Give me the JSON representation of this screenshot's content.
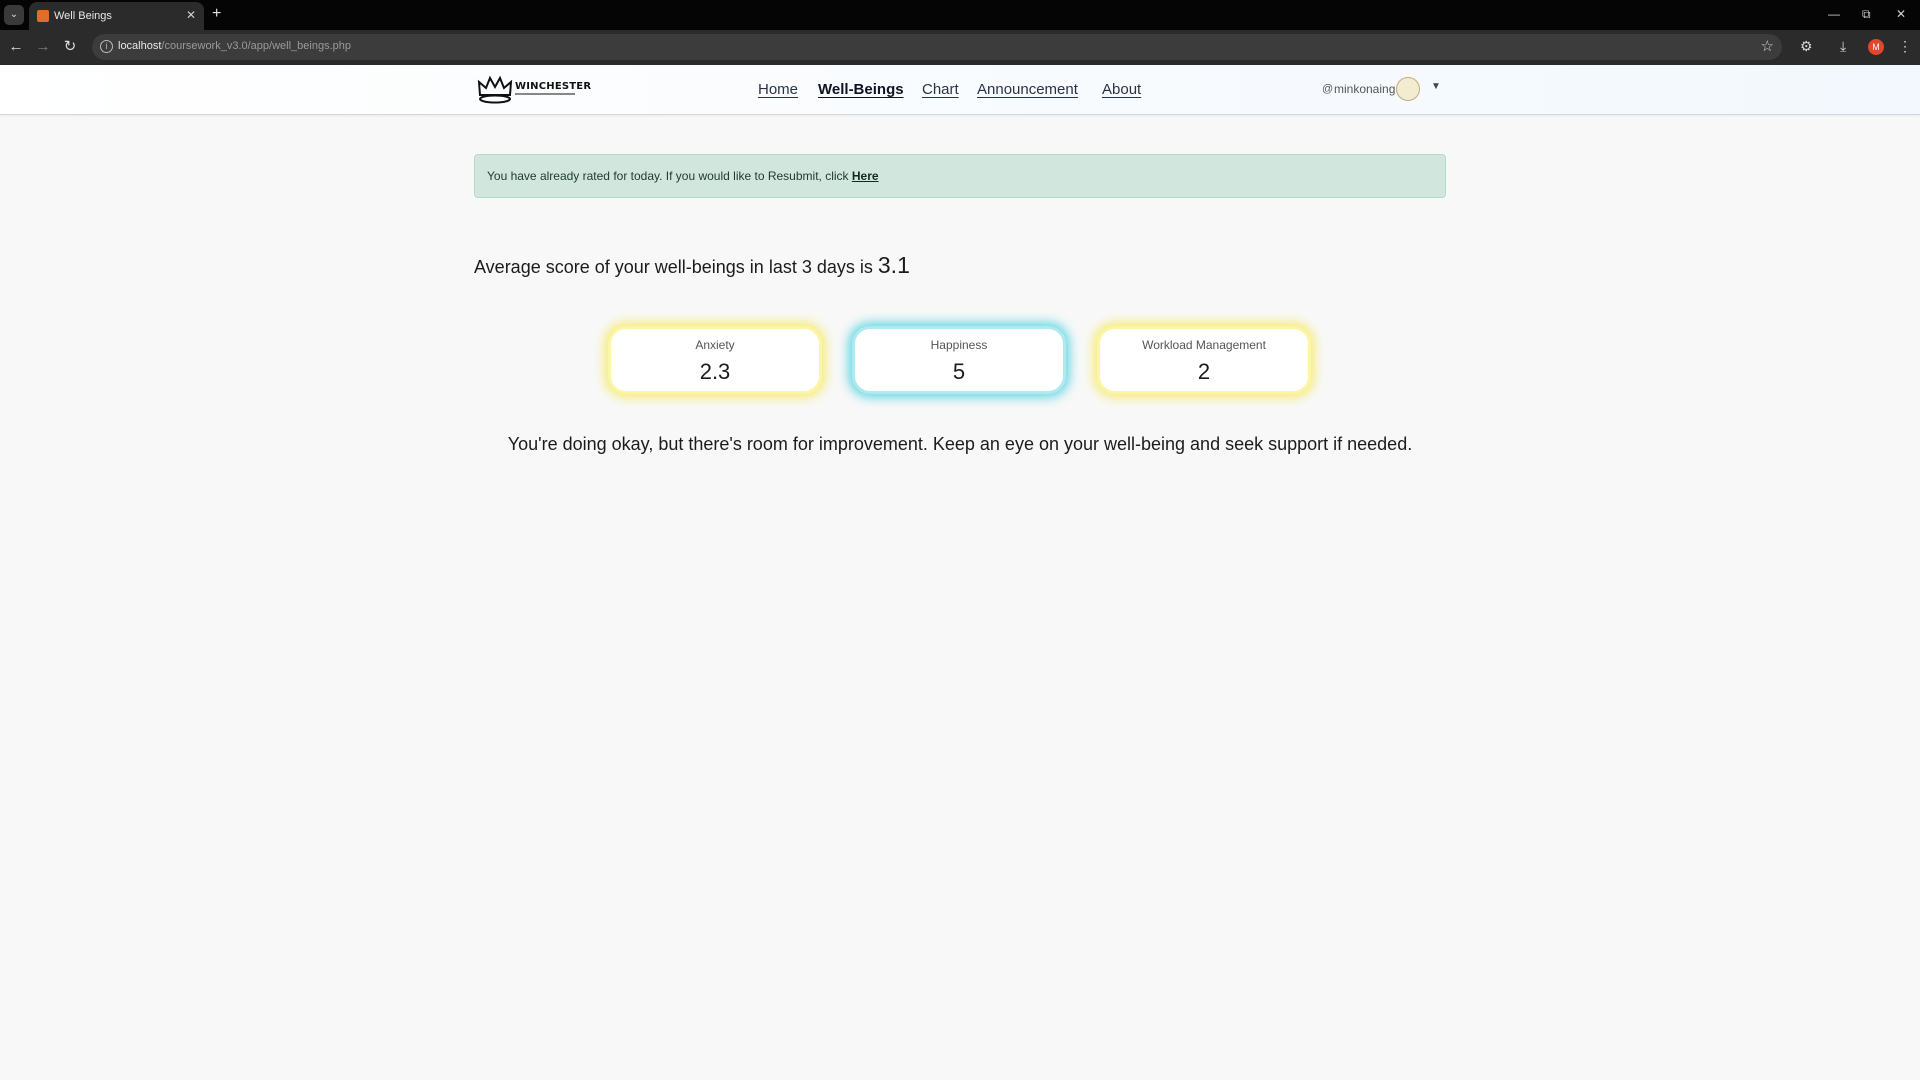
{
  "browser": {
    "tab_title": "Well Beings",
    "url_host": "localhost",
    "url_path": "/coursework_v3.0/app/well_beings.php",
    "profile_initial": "M"
  },
  "navbar": {
    "logo_text": "WINCHESTER",
    "links": [
      "Home",
      "Well-Beings",
      "Chart",
      "Announcement",
      "About"
    ],
    "active_link": "Well-Beings",
    "user_at": "@",
    "username": "minkonaing"
  },
  "alert": {
    "text": "You have already rated for today. If you would like to Resubmit, click",
    "link_label": "Here",
    "color": "#d1e7dd"
  },
  "summary": {
    "prefix": "Average score of your well-beings in last 3 days is",
    "value": "3.1"
  },
  "cards": [
    {
      "label": "Anxiety",
      "value": "2.3",
      "glow": "yellow"
    },
    {
      "label": "Happiness",
      "value": "5",
      "glow": "cyan"
    },
    {
      "label": "Workload Management",
      "value": "2",
      "glow": "yellow"
    }
  ],
  "message": "You're doing okay, but there's room for improvement. Keep an eye on your well-being and seek support if needed.",
  "colors": {
    "yellow_glow": "#f6e852",
    "cyan_glow": "#40cdde",
    "page_background": "#f8f8f8"
  }
}
